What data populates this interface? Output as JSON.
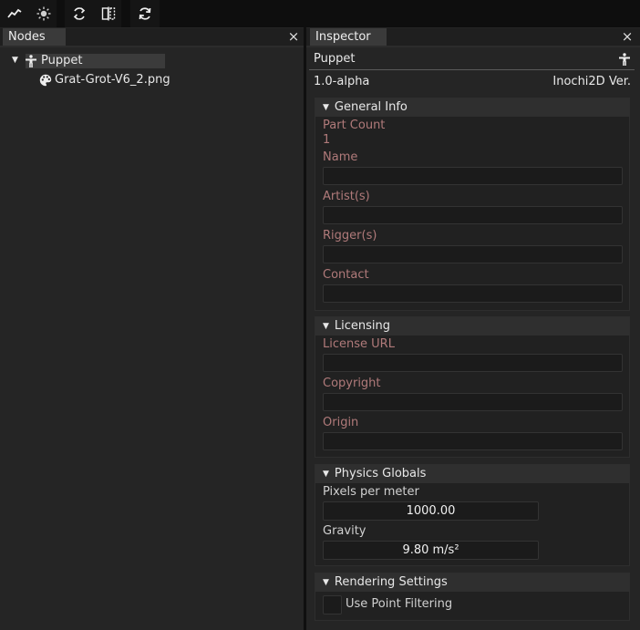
{
  "toolbar": {
    "buttons": [
      "chart-line-icon",
      "sun-icon",
      "sync-arrows-icon",
      "mirror-icon",
      "refresh-icon"
    ]
  },
  "nodes": {
    "tab_label": "Nodes",
    "close": "×",
    "tree": [
      {
        "label": "Puppet",
        "icon": "person-icon",
        "expanded": true,
        "selected": true
      },
      {
        "label": "Grat-Grot-V6_2.png",
        "icon": "palette-icon"
      }
    ],
    "expand_arrow": "▼"
  },
  "inspector": {
    "tab_label": "Inspector",
    "close": "×",
    "header_title": "Puppet",
    "version_value": "1.0-alpha",
    "version_label": "Inochi2D Ver.",
    "general_info": {
      "title": "General Info",
      "arrow": "▼",
      "part_count_label": "Part Count",
      "part_count_value": "1",
      "name_label": "Name",
      "name_value": "",
      "artists_label": "Artist(s)",
      "artists_value": "",
      "riggers_label": "Rigger(s)",
      "riggers_value": "",
      "contact_label": "Contact",
      "contact_value": ""
    },
    "licensing": {
      "title": "Licensing",
      "arrow": "▼",
      "license_url_label": "License URL",
      "license_url_value": "",
      "copyright_label": "Copyright",
      "copyright_value": "",
      "origin_label": "Origin",
      "origin_value": ""
    },
    "physics": {
      "title": "Physics Globals",
      "arrow": "▼",
      "ppm_label": "Pixels per meter",
      "ppm_value": "1000.00",
      "gravity_label": "Gravity",
      "gravity_value": "9.80 m/s²"
    },
    "rendering": {
      "title": "Rendering Settings",
      "arrow": "▼",
      "point_filtering_label": "Use Point Filtering",
      "point_filtering_checked": false
    }
  },
  "colors": {
    "background": "#252525",
    "toolbar": "#0e0e0e",
    "muted_label": "#b07a7a",
    "section_header": "#2f2f2f"
  }
}
